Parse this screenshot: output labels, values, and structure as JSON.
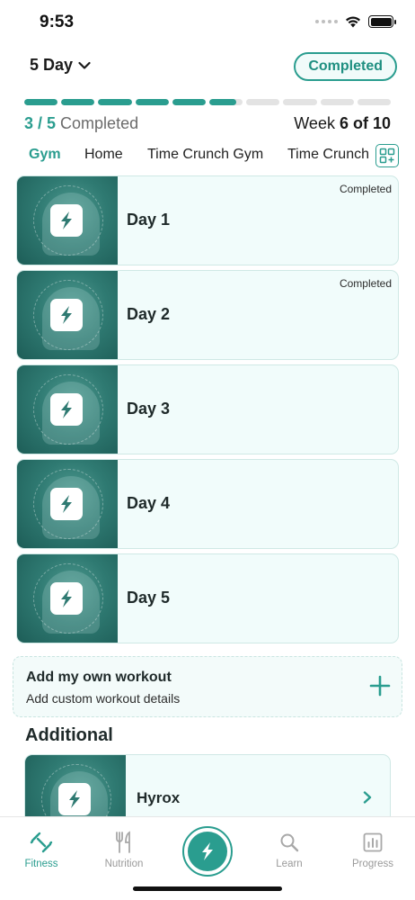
{
  "status_bar": {
    "time": "9:53"
  },
  "header": {
    "plan": "5 Day",
    "status_pill": "Completed"
  },
  "progress": {
    "segments": [
      1,
      1,
      1,
      1,
      1,
      0.8,
      0,
      0,
      0,
      0
    ]
  },
  "summary": {
    "completed_num": "3 / 5",
    "completed_word": "Completed",
    "week_prefix": "Week",
    "week_value": "6 of 10"
  },
  "tabs": [
    {
      "label": "Gym",
      "active": true
    },
    {
      "label": "Home",
      "active": false
    },
    {
      "label": "Time Crunch Gym",
      "active": false
    },
    {
      "label": "Time Crunch",
      "active": false
    }
  ],
  "days": [
    {
      "label": "Day 1",
      "status": "Completed"
    },
    {
      "label": "Day 2",
      "status": "Completed"
    },
    {
      "label": "Day 3",
      "status": ""
    },
    {
      "label": "Day 4",
      "status": ""
    },
    {
      "label": "Day 5",
      "status": ""
    }
  ],
  "add_workout": {
    "title": "Add my own workout",
    "subtitle": "Add custom workout details"
  },
  "additional": {
    "title": "Additional",
    "items": [
      {
        "label": "Hyrox"
      }
    ]
  },
  "nav": [
    {
      "label": "Fitness",
      "icon": "dumbbell-icon",
      "active": true
    },
    {
      "label": "Nutrition",
      "icon": "utensils-icon",
      "active": false
    },
    {
      "label": "Learn",
      "icon": "search-icon",
      "active": false
    },
    {
      "label": "Progress",
      "icon": "chart-icon",
      "active": false
    }
  ],
  "colors": {
    "accent": "#2a9d8f",
    "card_bg": "#f1fcfb",
    "card_border": "#cfe8e5"
  }
}
